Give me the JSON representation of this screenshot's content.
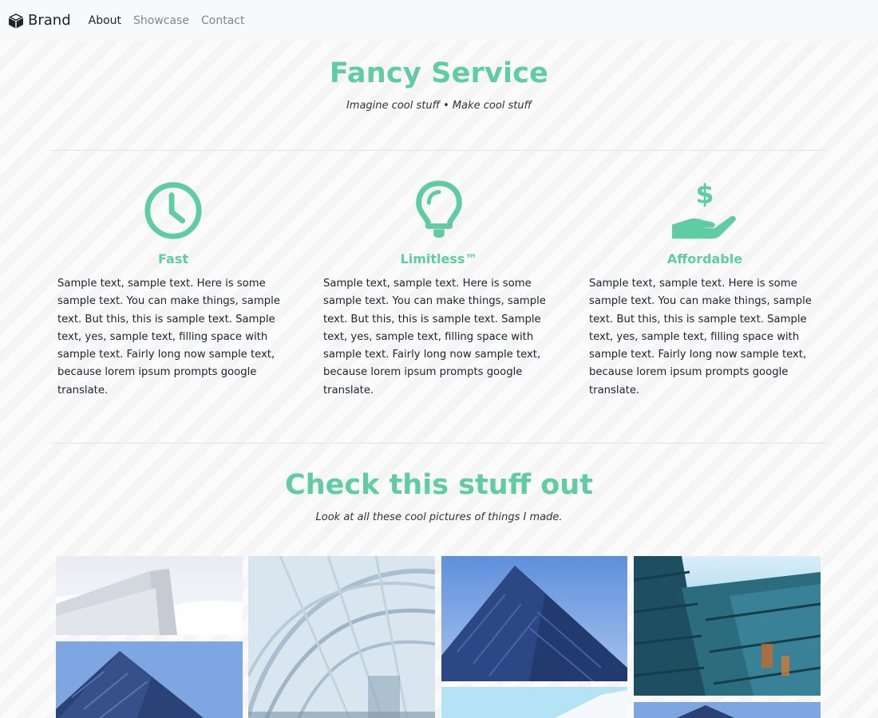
{
  "navbar": {
    "brand": "Brand",
    "links": [
      "About",
      "Showcase",
      "Contact"
    ]
  },
  "hero": {
    "title": "Fancy Service",
    "subtitle": "Imagine cool stuff • Make cool stuff"
  },
  "features": [
    {
      "icon": "clock-icon",
      "title": "Fast",
      "text": "Sample text, sample text. Here is some sample text. You can make things, sample text. But this, this is sample text. Sample text, yes, sample text, filling space with sample text. Fairly long now sample text, because lorem ipsum prompts google translate."
    },
    {
      "icon": "lightbulb-icon",
      "title": "Limitless™",
      "text": "Sample text, sample text. Here is some sample text. You can make things, sample text. But this, this is sample text. Sample text, yes, sample text, filling space with sample text. Fairly long now sample text, because lorem ipsum prompts google translate."
    },
    {
      "icon": "hand-dollar-icon",
      "title": "Affordable",
      "text": "Sample text, sample text. Here is some sample text. You can make things, sample text. But this, this is sample text. Sample text, yes, sample text, filling space with sample text. Fairly long now sample text, because lorem ipsum prompts google translate."
    }
  ],
  "showcase": {
    "title": "Check this stuff out",
    "subtitle": "Look at all these cool pictures of things I made."
  },
  "colors": {
    "accent": "#5fcca1",
    "navbar_bg": "#f8f9fa",
    "text": "#212529"
  }
}
